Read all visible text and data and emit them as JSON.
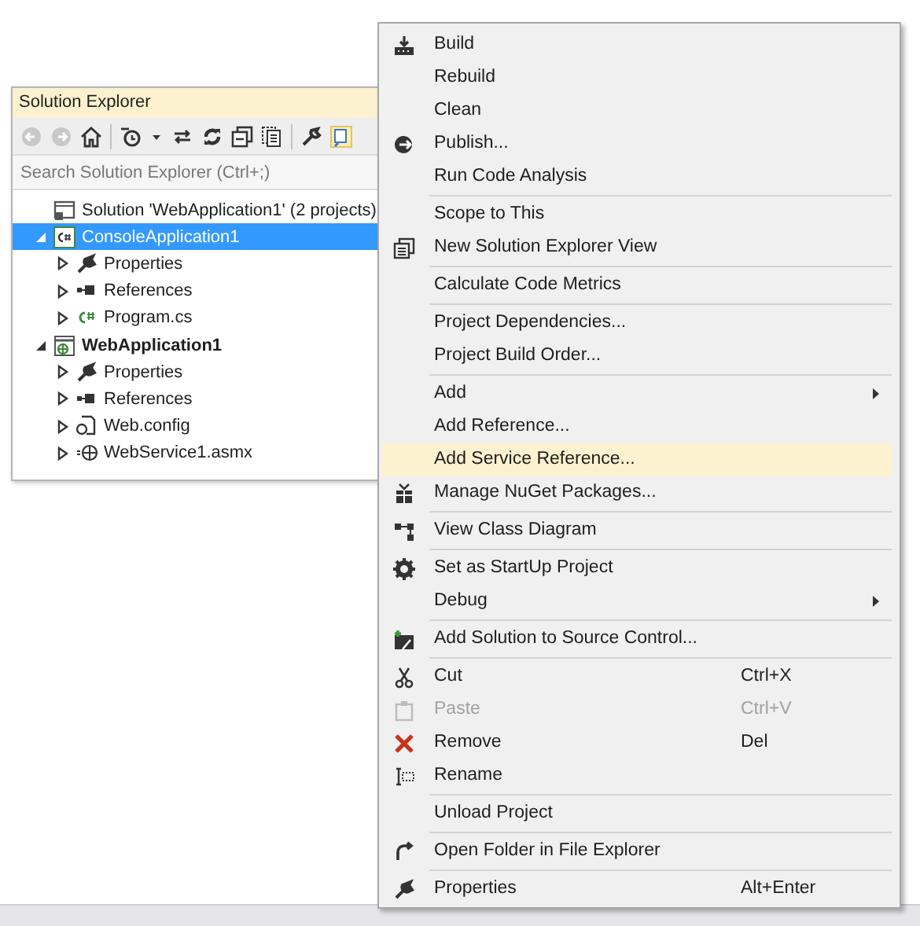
{
  "solution_explorer": {
    "title": "Solution Explorer",
    "search": {
      "placeholder": "Search Solution Explorer (Ctrl+;)"
    },
    "tree": [
      {
        "label": "Solution 'WebApplication1' (2 projects)",
        "selected": false,
        "bold": false,
        "children": [
          {
            "label": "ConsoleApplication1",
            "selected": true,
            "bold": false,
            "expanded": true,
            "children": [
              {
                "label": "Properties",
                "selected": false,
                "bold": false,
                "expanded": false
              },
              {
                "label": "References",
                "selected": false,
                "bold": false,
                "expanded": false
              },
              {
                "label": "Program.cs",
                "selected": false,
                "bold": false,
                "expanded": false
              }
            ]
          },
          {
            "label": "WebApplication1",
            "selected": false,
            "bold": true,
            "expanded": true,
            "children": [
              {
                "label": "Properties",
                "selected": false,
                "bold": false,
                "expanded": false
              },
              {
                "label": "References",
                "selected": false,
                "bold": false,
                "expanded": false
              },
              {
                "label": "Web.config",
                "selected": false,
                "bold": false,
                "expanded": false
              },
              {
                "label": "WebService1.asmx",
                "selected": false,
                "bold": false,
                "expanded": false
              }
            ]
          }
        ]
      }
    ]
  },
  "context_menu": {
    "groups": [
      [
        {
          "label": "Build",
          "selected": false,
          "disabled": false
        },
        {
          "label": "Rebuild",
          "selected": false,
          "disabled": false
        },
        {
          "label": "Clean",
          "selected": false,
          "disabled": false
        },
        {
          "label": "Publish...",
          "selected": false,
          "disabled": false
        },
        {
          "label": "Run Code Analysis",
          "selected": false,
          "disabled": false
        }
      ],
      [
        {
          "label": "Scope to This",
          "selected": false,
          "disabled": false
        },
        {
          "label": "New Solution Explorer View",
          "selected": false,
          "disabled": false
        }
      ],
      [
        {
          "label": "Calculate Code Metrics",
          "selected": false,
          "disabled": false
        }
      ],
      [
        {
          "label": "Project Dependencies...",
          "selected": false,
          "disabled": false
        },
        {
          "label": "Project Build Order...",
          "selected": false,
          "disabled": false
        }
      ],
      [
        {
          "label": "Add",
          "selected": false,
          "disabled": false,
          "submenu": true
        },
        {
          "label": "Add Reference...",
          "selected": false,
          "disabled": false
        },
        {
          "label": "Add Service Reference...",
          "selected": true,
          "disabled": false
        },
        {
          "label": "Manage NuGet Packages...",
          "selected": false,
          "disabled": false
        }
      ],
      [
        {
          "label": "View Class Diagram",
          "selected": false,
          "disabled": false
        }
      ],
      [
        {
          "label": "Set as StartUp Project",
          "selected": false,
          "disabled": false
        },
        {
          "label": "Debug",
          "selected": false,
          "disabled": false,
          "submenu": true
        }
      ],
      [
        {
          "label": "Add Solution to Source Control...",
          "selected": false,
          "disabled": false
        }
      ],
      [
        {
          "label": "Cut",
          "shortcut": "Ctrl+X",
          "selected": false,
          "disabled": false
        },
        {
          "label": "Paste",
          "shortcut": "Ctrl+V",
          "selected": false,
          "disabled": true
        },
        {
          "label": "Remove",
          "shortcut": "Del",
          "selected": false,
          "disabled": false
        },
        {
          "label": "Rename",
          "selected": false,
          "disabled": false
        }
      ],
      [
        {
          "label": "Unload Project",
          "selected": false,
          "disabled": false
        }
      ],
      [
        {
          "label": "Open Folder in File Explorer",
          "selected": false,
          "disabled": false
        }
      ],
      [
        {
          "label": "Properties",
          "shortcut": "Alt+Enter",
          "selected": false,
          "disabled": false
        }
      ]
    ]
  }
}
